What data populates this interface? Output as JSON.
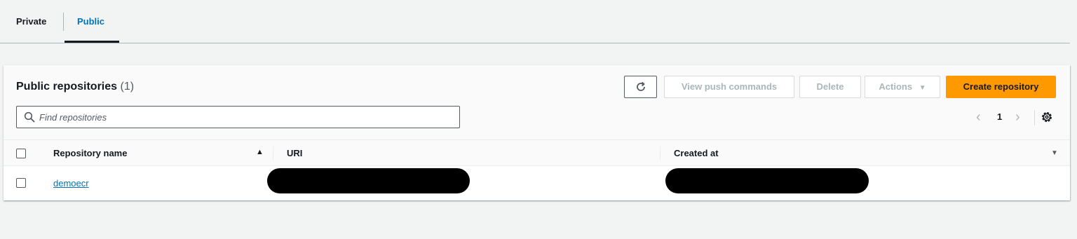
{
  "tabs": [
    {
      "label": "Private",
      "selected": false
    },
    {
      "label": "Public",
      "selected": true
    }
  ],
  "panel": {
    "title": "Public repositories",
    "count": "(1)"
  },
  "toolbar": {
    "refresh_icon": "refresh-icon",
    "view_push_label": "View push commands",
    "delete_label": "Delete",
    "actions_label": "Actions",
    "create_label": "Create repository"
  },
  "search": {
    "placeholder": "Find repositories",
    "value": ""
  },
  "pagination": {
    "current_page": "1"
  },
  "table": {
    "columns": [
      "Repository name",
      "URI",
      "Created at"
    ],
    "rows": [
      {
        "name": "demoecr",
        "uri": "[redacted]",
        "created_at": "[redacted]"
      }
    ]
  },
  "colors": {
    "accent": "#0073bb",
    "primary_button": "#ff9900",
    "background": "#f2f3f3"
  }
}
